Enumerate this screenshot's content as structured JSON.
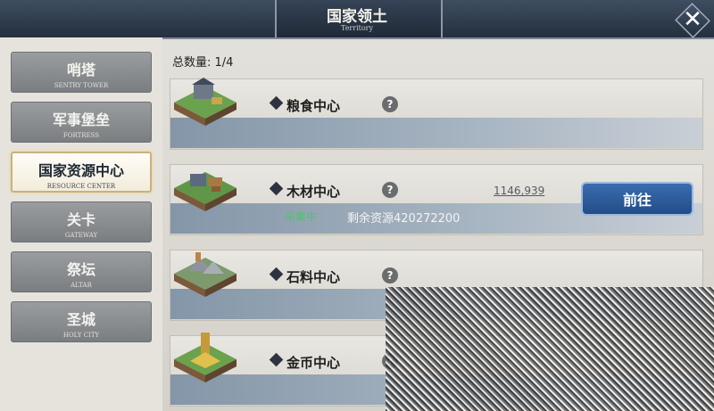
{
  "header": {
    "title": "国家领土",
    "subtitle": "Territory",
    "close_icon": "close-icon"
  },
  "sidebar": {
    "items": [
      {
        "cn": "哨塔",
        "en": "SENTRY TOWER",
        "active": false
      },
      {
        "cn": "军事堡垒",
        "en": "FORTRESS",
        "active": false
      },
      {
        "cn": "国家资源中心",
        "en": "RESOURCE CENTER",
        "active": true
      },
      {
        "cn": "关卡",
        "en": "GATEWAY",
        "active": false
      },
      {
        "cn": "祭坛",
        "en": "ALTAR",
        "active": false
      },
      {
        "cn": "圣城",
        "en": "HOLY CITY",
        "active": false
      }
    ]
  },
  "main": {
    "total_label": "总数量: 1/4",
    "cards": [
      {
        "name": "粮食中心",
        "icon": "farm-tile-icon"
      },
      {
        "name": "木材中心",
        "icon": "lumber-tile-icon",
        "status": "采集中",
        "remaining": "剩余资源420272200",
        "coords": "1146,939",
        "goto_label": "前往"
      },
      {
        "name": "石料中心",
        "icon": "quarry-tile-icon"
      },
      {
        "name": "金币中心",
        "icon": "gold-tile-icon"
      }
    ]
  },
  "colors": {
    "accent": "#2c5b9c",
    "status_green": "#4fc36a",
    "banner": "#2d3a4a"
  }
}
